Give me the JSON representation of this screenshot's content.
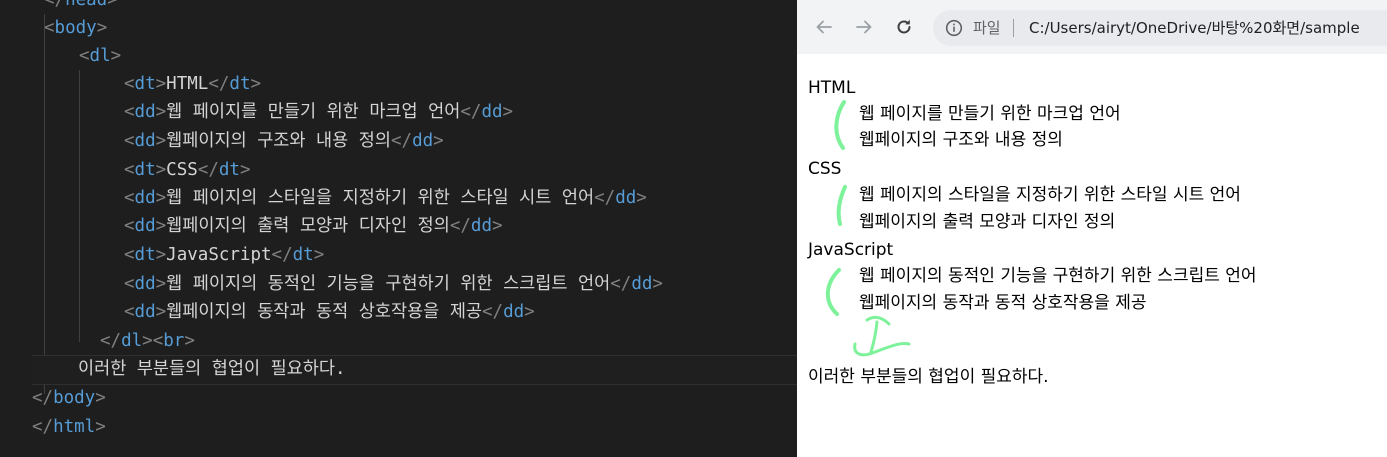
{
  "editor": {
    "lines": [
      {
        "indent": "",
        "tag_open": "</",
        "tag": "head",
        "tag_close": ">",
        "text": "",
        "end_open": "",
        "end_tag": "",
        "end_close": ""
      },
      {
        "indent": "  ",
        "tag_open": "<",
        "tag": "body",
        "tag_close": ">",
        "text": "",
        "end_open": "",
        "end_tag": "",
        "end_close": ""
      },
      {
        "indent": "    ",
        "tag_open": "<",
        "tag": "dl",
        "tag_close": ">",
        "text": "",
        "end_open": "",
        "end_tag": "",
        "end_close": ""
      },
      {
        "indent": "       ",
        "tag_open": "<",
        "tag": "dt",
        "tag_close": ">",
        "text": "HTML",
        "end_open": "</",
        "end_tag": "dt",
        "end_close": ">"
      },
      {
        "indent": "       ",
        "tag_open": "<",
        "tag": "dd",
        "tag_close": ">",
        "text": "웹 페이지를 만들기 위한 마크업 언어",
        "end_open": "</",
        "end_tag": "dd",
        "end_close": ">"
      },
      {
        "indent": "       ",
        "tag_open": "<",
        "tag": "dd",
        "tag_close": ">",
        "text": "웹페이지의 구조와 내용 정의",
        "end_open": "</",
        "end_tag": "dd",
        "end_close": ">"
      },
      {
        "indent": "       ",
        "tag_open": "<",
        "tag": "dt",
        "tag_close": ">",
        "text": "CSS",
        "end_open": "</",
        "end_tag": "dt",
        "end_close": ">"
      },
      {
        "indent": "       ",
        "tag_open": "<",
        "tag": "dd",
        "tag_close": ">",
        "text": "웹 페이지의 스타일을 지정하기 위한 스타일 시트 언어",
        "end_open": "</",
        "end_tag": "dd",
        "end_close": ">"
      },
      {
        "indent": "       ",
        "tag_open": "<",
        "tag": "dd",
        "tag_close": ">",
        "text": "웹페이지의 출력 모양과 디자인 정의",
        "end_open": "</",
        "end_tag": "dd",
        "end_close": ">"
      },
      {
        "indent": "       ",
        "tag_open": "<",
        "tag": "dt",
        "tag_close": ">",
        "text": "JavaScript",
        "end_open": "</",
        "end_tag": "dt",
        "end_close": ">"
      },
      {
        "indent": "       ",
        "tag_open": "<",
        "tag": "dd",
        "tag_close": ">",
        "text": "웹 페이지의 동적인 기능을 구현하기 위한 스크립트 언어",
        "end_open": "</",
        "end_tag": "dd",
        "end_close": ">"
      },
      {
        "indent": "       ",
        "tag_open": "<",
        "tag": "dd",
        "tag_close": ">",
        "text": "웹페이지의 동작과 동적 상호작용을 제공",
        "end_open": "</",
        "end_tag": "dd",
        "end_close": ">"
      },
      {
        "indent": "     ",
        "tag_open": "</",
        "tag": "dl",
        "tag_close": "><",
        "text": "",
        "end_open": "",
        "end_tag": "br",
        "end_close": ">"
      },
      {
        "indent": "",
        "tag_open": "",
        "tag": "",
        "tag_close": "",
        "text": "이러한 부분들의 협업이 필요하다.",
        "end_open": "",
        "end_tag": "",
        "end_close": ""
      },
      {
        "indent": "  ",
        "tag_open": "</",
        "tag": "body",
        "tag_close": ">",
        "text": "",
        "end_open": "",
        "end_tag": "",
        "end_close": ""
      },
      {
        "indent": "  ",
        "tag_open": "</",
        "tag": "html",
        "tag_close": ">",
        "text": "",
        "end_open": "",
        "end_tag": "",
        "end_close": ""
      }
    ]
  },
  "browser": {
    "scheme_label": "파일",
    "url": "C:/Users/airyt/OneDrive/바탕%20화면/sample",
    "icons": {
      "back": "arrow-left-icon",
      "forward": "arrow-right-icon",
      "reload": "reload-icon",
      "info": "info-circle-icon"
    }
  },
  "page": {
    "terms": [
      {
        "term": "HTML",
        "defs": [
          "웹 페이지를 만들기 위한 마크업 언어",
          "웹페이지의 구조와 내용 정의"
        ]
      },
      {
        "term": "CSS",
        "defs": [
          "웹 페이지의 스타일을 지정하기 위한 스타일 시트 언어",
          "웹페이지의 출력 모양과 디자인 정의"
        ]
      },
      {
        "term": "JavaScript",
        "defs": [
          "웹 페이지의 동적인 기능을 구현하기 위한 스크립트 언어",
          "웹페이지의 동작과 동적 상호작용을 제공"
        ]
      }
    ],
    "footer_text": "이러한 부분들의 협업이 필요하다."
  },
  "colors": {
    "tag": "#569cd6",
    "bracket": "#808080",
    "text": "#d4d4d4",
    "annotation": "#7ef29a"
  }
}
